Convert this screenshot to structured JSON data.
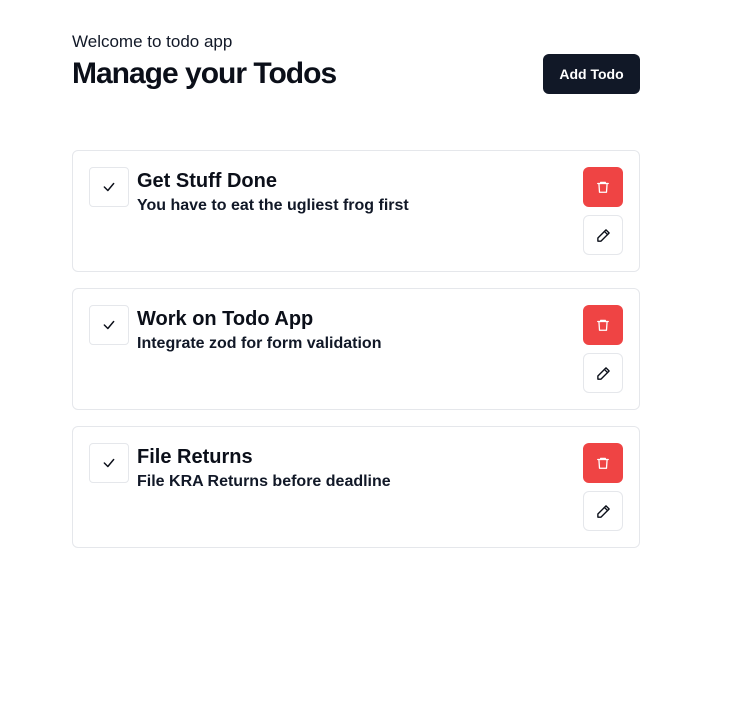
{
  "header": {
    "welcome": "Welcome to todo app",
    "title": "Manage your Todos",
    "add_button_label": "Add Todo"
  },
  "todos": [
    {
      "title": "Get Stuff Done",
      "description": "You have to eat the ugliest frog first"
    },
    {
      "title": "Work on Todo App",
      "description": "Integrate zod for form validation"
    },
    {
      "title": "File Returns",
      "description": "File KRA Returns before deadline"
    }
  ],
  "icons": {
    "check": "check-icon",
    "delete": "trash-icon",
    "edit": "pencil-icon"
  },
  "colors": {
    "primary_button": "#111827",
    "delete_button": "#ef4444",
    "border": "#e5e7eb"
  }
}
